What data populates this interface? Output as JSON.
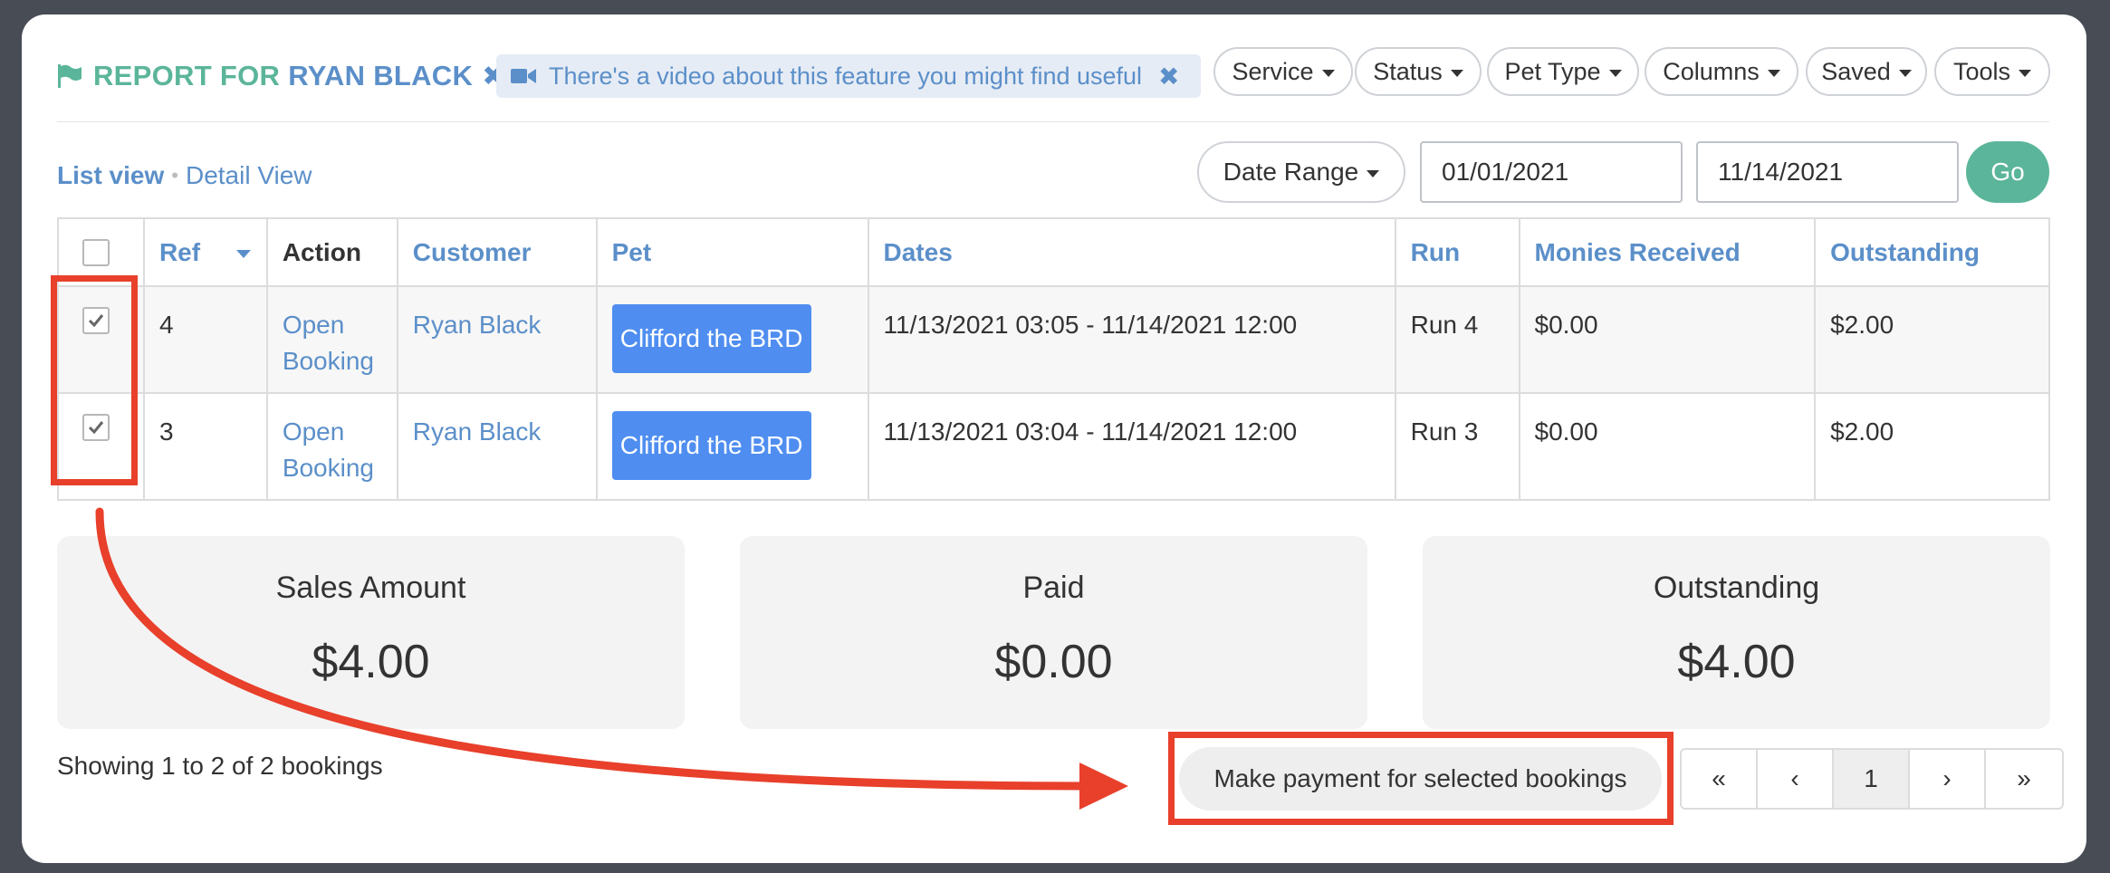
{
  "header": {
    "title_prefix": "REPORT FOR",
    "title_name": "RYAN BLACK",
    "close_glyph": "✖",
    "video_tip": "There's a video about this feature you might find useful",
    "video_close_glyph": "✖",
    "filters": [
      "Service",
      "Status",
      "Pet Type",
      "Columns",
      "Saved",
      "Tools"
    ]
  },
  "view": {
    "list_label": "List view",
    "separator": "•",
    "detail_label": "Detail View"
  },
  "date_filter": {
    "range_label": "Date Range",
    "from": "01/01/2021",
    "to": "11/14/2021",
    "go_label": "Go"
  },
  "table": {
    "columns": [
      "Ref",
      "Action",
      "Customer",
      "Pet",
      "Dates",
      "Run",
      "Monies Received",
      "Outstanding"
    ],
    "rows": [
      {
        "selected": true,
        "ref": "4",
        "action_line1": "Open",
        "action_line2": "Booking",
        "customer": "Ryan Black",
        "pet": "Clifford the BRD",
        "dates": "11/13/2021 03:05 - 11/14/2021 12:00",
        "run": "Run 4",
        "received": "$0.00",
        "outstanding": "$2.00"
      },
      {
        "selected": true,
        "ref": "3",
        "action_line1": "Open",
        "action_line2": "Booking",
        "customer": "Ryan Black",
        "pet": "Clifford the BRD",
        "dates": "11/13/2021 03:04 - 11/14/2021 12:00",
        "run": "Run 3",
        "received": "$0.00",
        "outstanding": "$2.00"
      }
    ]
  },
  "summary": [
    {
      "label": "Sales Amount",
      "value": "$4.00"
    },
    {
      "label": "Paid",
      "value": "$0.00"
    },
    {
      "label": "Outstanding",
      "value": "$4.00"
    }
  ],
  "footer": {
    "showing": "Showing 1 to 2 of 2 bookings",
    "make_payment": "Make payment for selected bookings",
    "pager": [
      "«",
      "‹",
      "1",
      "›",
      "»"
    ]
  },
  "colors": {
    "accent_green": "#5bb59a",
    "accent_blue": "#5b8fc9",
    "pet_chip": "#4f8ef0",
    "annotation_red": "#e8402b"
  }
}
